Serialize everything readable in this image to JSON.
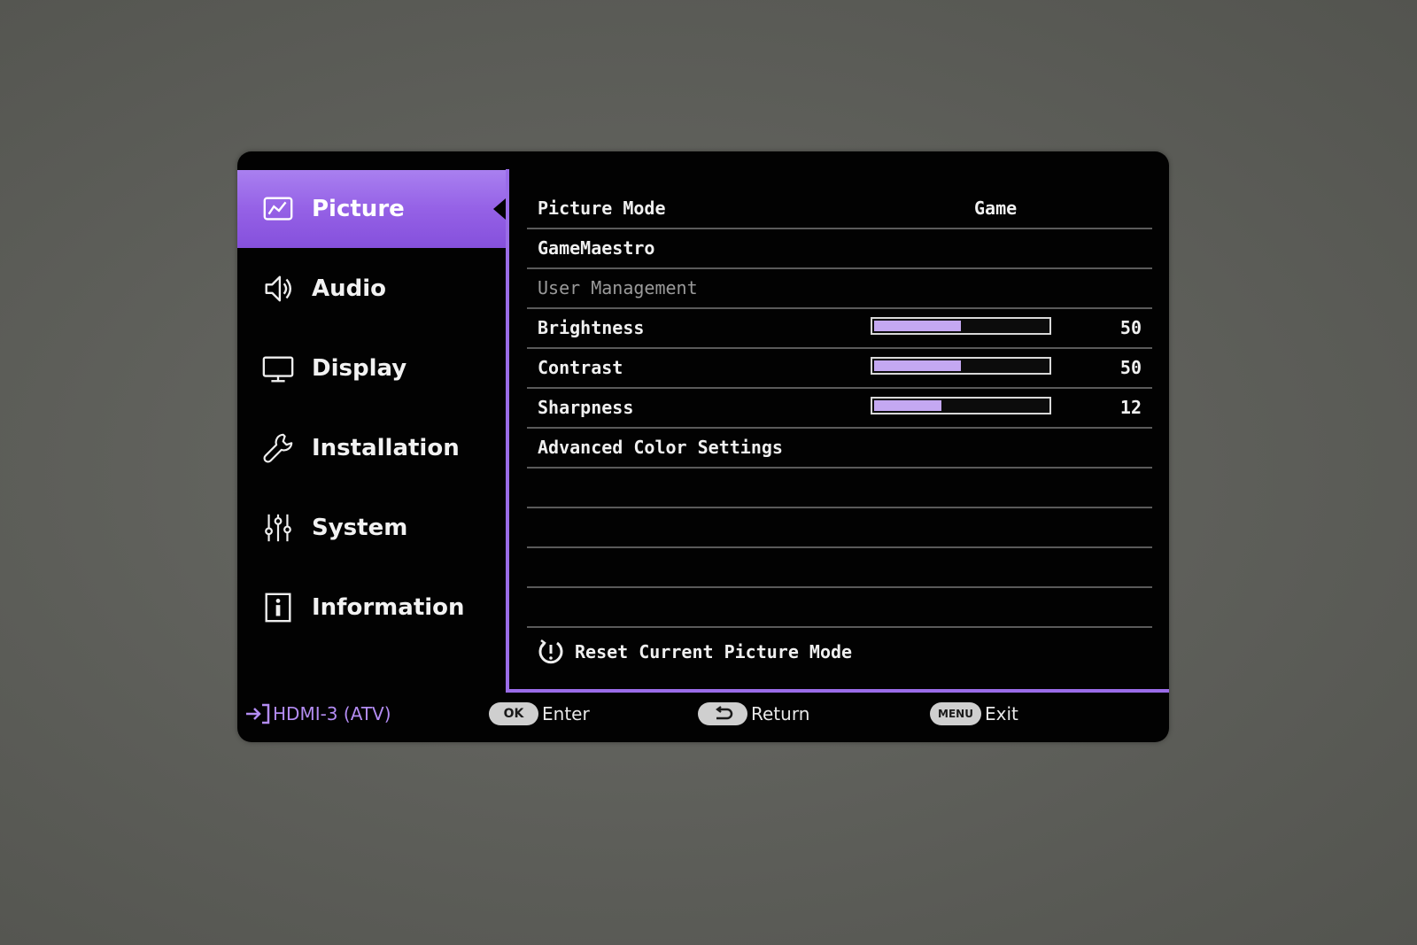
{
  "colors": {
    "accent": "#9561e6",
    "slider_fill": "#c4a8f2",
    "source_text": "#b38cf2"
  },
  "sidebar": {
    "items": [
      {
        "label": "Picture",
        "icon": "picture-icon",
        "active": true
      },
      {
        "label": "Audio",
        "icon": "speaker-icon",
        "active": false
      },
      {
        "label": "Display",
        "icon": "monitor-icon",
        "active": false
      },
      {
        "label": "Installation",
        "icon": "wrench-icon",
        "active": false
      },
      {
        "label": "System",
        "icon": "sliders-icon",
        "active": false
      },
      {
        "label": "Information",
        "icon": "info-icon",
        "active": false
      }
    ]
  },
  "picture_menu": {
    "picture_mode": {
      "label": "Picture Mode",
      "value": "Game"
    },
    "gamemaestro": {
      "label": "GameMaestro"
    },
    "user_management": {
      "label": "User Management",
      "enabled": false
    },
    "brightness": {
      "label": "Brightness",
      "value": 50,
      "display": "50",
      "max": 100
    },
    "contrast": {
      "label": "Contrast",
      "value": 50,
      "display": "50",
      "max": 100
    },
    "sharpness": {
      "label": "Sharpness",
      "value": 12,
      "display": "12",
      "max": 31
    },
    "advanced": {
      "label": "Advanced Color Settings"
    },
    "reset": {
      "label": "Reset Current Picture Mode",
      "icon": "reset-icon"
    }
  },
  "footer": {
    "source": "HDMI-3 (ATV)",
    "source_icon": "input-source-icon",
    "ok": {
      "key": "OK",
      "label": "Enter"
    },
    "back": {
      "key_icon": "return-arrow-icon",
      "label": "Return"
    },
    "menu": {
      "key": "MENU",
      "label": "Exit"
    }
  }
}
